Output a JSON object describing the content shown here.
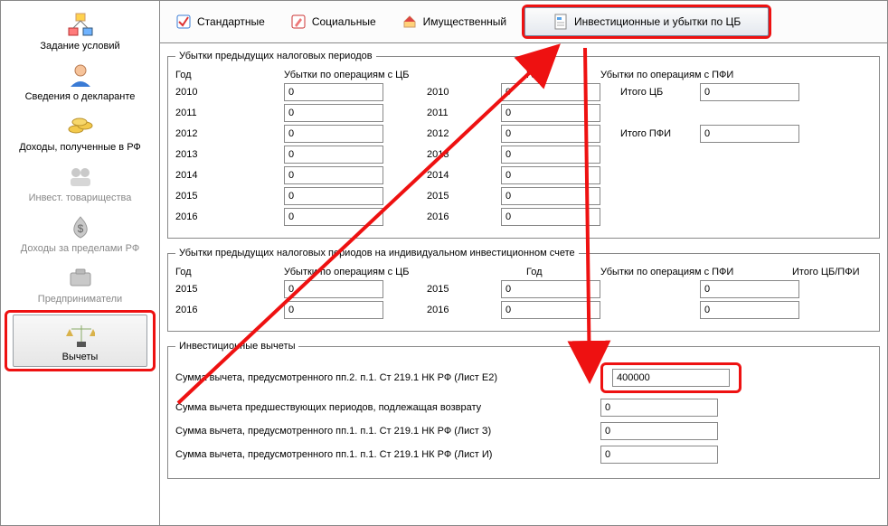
{
  "sidebar": {
    "items": [
      {
        "label": "Задание условий",
        "icon": "diagram-icon"
      },
      {
        "label": "Сведения о декларанте",
        "icon": "person-icon"
      },
      {
        "label": "Доходы, полученные в РФ",
        "icon": "coins-icon"
      },
      {
        "label": "Инвест. товарищества",
        "icon": "partners-icon",
        "disabled": true
      },
      {
        "label": "Доходы за пределами РФ",
        "icon": "money-bag-icon",
        "disabled": true
      },
      {
        "label": "Предприниматели",
        "icon": "briefcase-icon",
        "disabled": true
      },
      {
        "label": "Вычеты",
        "icon": "scales-icon",
        "active": true
      }
    ]
  },
  "toolbar": {
    "tabs": [
      {
        "label": "Стандартные",
        "icon": "check-icon"
      },
      {
        "label": "Социальные",
        "icon": "edit-icon"
      },
      {
        "label": "Имущественный",
        "icon": "house-icon"
      },
      {
        "label": "Инвестиционные и убытки по ЦБ",
        "icon": "document-icon",
        "active": true
      }
    ]
  },
  "group1": {
    "title": "Убытки предыдущих налоговых периодов",
    "headers": {
      "year": "Год",
      "cb": "Убытки по операциям с ЦБ",
      "pfi": "Убытки по операциям с ПФИ",
      "tot_cb": "Итого ЦБ",
      "tot_pfi": "Итого ПФИ"
    },
    "rows": [
      {
        "y1": "2010",
        "cb": "0",
        "y2": "2010",
        "pfi": "0",
        "tot_label": "Итого ЦБ",
        "tot": "0"
      },
      {
        "y1": "2011",
        "cb": "0",
        "y2": "2011",
        "pfi": "0"
      },
      {
        "y1": "2012",
        "cb": "0",
        "y2": "2012",
        "pfi": "0",
        "tot_label": "Итого ПФИ",
        "tot": "0"
      },
      {
        "y1": "2013",
        "cb": "0",
        "y2": "2013",
        "pfi": "0"
      },
      {
        "y1": "2014",
        "cb": "0",
        "y2": "2014",
        "pfi": "0"
      },
      {
        "y1": "2015",
        "cb": "0",
        "y2": "2015",
        "pfi": "0"
      },
      {
        "y1": "2016",
        "cb": "0",
        "y2": "2016",
        "pfi": "0"
      }
    ]
  },
  "group2": {
    "title": "Убытки предыдущих налоговых периодов на индивидуальном инвестиционном счете",
    "headers": {
      "year": "Год",
      "cb": "Убытки по операциям с ЦБ",
      "pfi": "Убытки по операциям с ПФИ",
      "tot": "Итого ЦБ/ПФИ"
    },
    "rows": [
      {
        "y1": "2015",
        "cb": "0",
        "y2": "2015",
        "pfi": "0",
        "tot": "0"
      },
      {
        "y1": "2016",
        "cb": "0",
        "y2": "2016",
        "pfi": "0",
        "tot": "0"
      }
    ]
  },
  "group3": {
    "title": "Инвестиционные вычеты",
    "rows": [
      {
        "label": "Сумма вычета, предусмотренного пп.2. п.1. Ст 219.1 НК РФ (Лист Е2)",
        "value": "400000",
        "highlight": true
      },
      {
        "label": "Сумма вычета предшествующих периодов, подлежащая возврату",
        "value": "0"
      },
      {
        "label": "Сумма вычета, предусмотренного пп.1. п.1. Ст 219.1 НК РФ (Лист З)",
        "value": "0"
      },
      {
        "label": "Сумма вычета, предусмотренного пп.1. п.1. Ст 219.1 НК РФ (Лист И)",
        "value": "0"
      }
    ]
  },
  "colors": {
    "accent": "#e11"
  }
}
